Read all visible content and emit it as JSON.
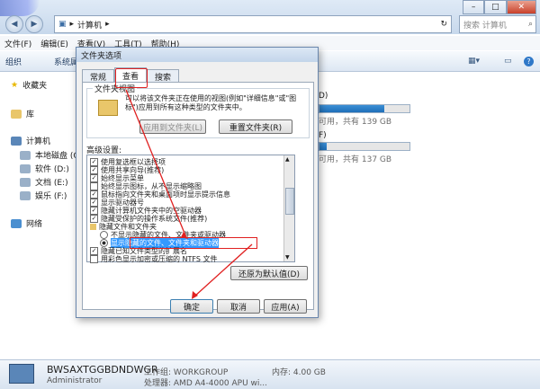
{
  "explorer": {
    "breadcrumb": "计算机",
    "search_placeholder": "搜索 计算机",
    "menu": [
      "文件(F)",
      "编辑(E)",
      "查看(V)",
      "工具(T)",
      "帮助(H)"
    ],
    "toolbar": [
      "组织",
      "系统属"
    ],
    "nav": {
      "favorites": "收藏夹",
      "library": "库",
      "computer": "计算机",
      "local_disk": "本地磁盘 (C:)",
      "software": "软件 (D:)",
      "documents": "文档 (E:)",
      "entertainment": "娱乐 (F:)",
      "network": "网络"
    },
    "drives": [
      {
        "letter": "D)",
        "free": "可用，共有 139 GB",
        "used_fraction": 0.72
      },
      {
        "letter": "F)",
        "free": "可用，共有 137 GB",
        "used_fraction": 0.08
      }
    ],
    "details": {
      "pc_name": "BWSAXTGGBDNDWGR",
      "workgroup": "工作组: WORKGROUP",
      "memory": "内存: 4.00 GB",
      "user": "Administrator",
      "cpu": "处理器: AMD A4-4000 APU wi..."
    }
  },
  "dialog": {
    "title": "文件夹选项",
    "tabs": [
      "常规",
      "查看",
      "搜索"
    ],
    "group_title": "文件夹视图",
    "group_desc": "可以将该文件夹正在使用的视图(例如\"详细信息\"或\"图标\")应用到所有这种类型的文件夹中。",
    "apply_to_folders": "应用到文件夹(L)",
    "reset_folders": "重置文件夹(R)",
    "advanced_label": "高级设置:",
    "advanced_items": [
      {
        "type": "check",
        "checked": true,
        "label": "使用复选框以选择项"
      },
      {
        "type": "check",
        "checked": true,
        "label": "使用共享向导(推荐)"
      },
      {
        "type": "check",
        "checked": true,
        "label": "始终显示菜单"
      },
      {
        "type": "check",
        "checked": false,
        "label": "始终显示图标，从不显示缩略图"
      },
      {
        "type": "check",
        "checked": true,
        "label": "鼠标指向文件夹和桌面项时显示提示信息"
      },
      {
        "type": "check",
        "checked": true,
        "label": "显示驱动器号"
      },
      {
        "type": "check",
        "checked": true,
        "label": "隐藏计算机文件夹中的空驱动器"
      },
      {
        "type": "check",
        "checked": true,
        "label": "隐藏受保护的操作系统文件(推荐)"
      },
      {
        "type": "folder",
        "label": "隐藏文件和文件夹"
      },
      {
        "type": "radio",
        "checked": false,
        "label": "不显示隐藏的文件、文件夹或驱动器"
      },
      {
        "type": "radio",
        "checked": true,
        "label": "显示隐藏的文件、文件夹和驱动器"
      },
      {
        "type": "check",
        "checked": true,
        "label": "隐藏已知文件类型的扩展名"
      },
      {
        "type": "check",
        "checked": false,
        "label": "用彩色显示加密或压缩的 NTFS 文件"
      }
    ],
    "restore_defaults": "还原为默认值(D)",
    "ok": "确定",
    "cancel": "取消",
    "apply": "应用(A)"
  }
}
